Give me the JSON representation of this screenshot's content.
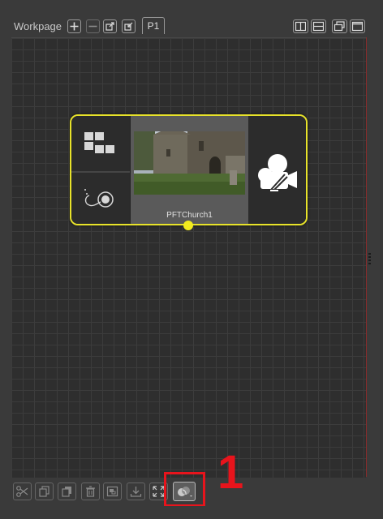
{
  "workpage": {
    "title": "Workpage",
    "tabs": [
      {
        "label": "P1"
      }
    ],
    "buttons": [
      "add-page",
      "remove-page",
      "export-page",
      "import-page"
    ],
    "view_buttons": [
      "split-vertical",
      "split-horizontal",
      "float-window",
      "maximize-window"
    ]
  },
  "node": {
    "label": "PFTChurch1",
    "border_color": "#e8e32a",
    "pin_color": "#f2ec1e"
  },
  "toolbar": {
    "buttons": [
      "cut",
      "copy",
      "duplicate",
      "delete",
      "group",
      "import",
      "fit-view",
      "node-mask"
    ],
    "active": "node-mask"
  },
  "annotation": {
    "callout_text": "1",
    "color": "#e8141c"
  }
}
